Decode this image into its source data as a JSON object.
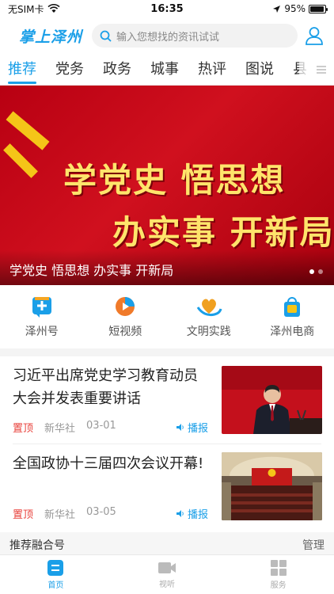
{
  "status_bar": {
    "carrier": "无SIM卡",
    "time": "16:35",
    "battery": "95%",
    "battery_level": 0.95
  },
  "header": {
    "logo": "掌上泽州",
    "search_placeholder": "输入您想找的资讯试试"
  },
  "tabs": [
    {
      "label": "推荐",
      "active": true
    },
    {
      "label": "党务"
    },
    {
      "label": "政务"
    },
    {
      "label": "城事"
    },
    {
      "label": "热评"
    },
    {
      "label": "图说"
    },
    {
      "label": "县"
    }
  ],
  "banner": {
    "line1": "学党史 悟思想",
    "line2": "办实事 开新局",
    "caption": "学党史 悟思想 办实事 开新局",
    "slides": 2,
    "current": 1
  },
  "quick_links": [
    {
      "label": "泽州号",
      "icon": "plus-badge-icon",
      "color": "#1a9fe8"
    },
    {
      "label": "短视频",
      "icon": "video-play-icon",
      "color": "#f07a2a"
    },
    {
      "label": "文明实践",
      "icon": "heart-hands-icon",
      "color": "#f0a020"
    },
    {
      "label": "泽州电商",
      "icon": "shopping-bag-icon",
      "color": "#1a9fe8"
    }
  ],
  "news": [
    {
      "title": "习近平出席党史学习教育动员大会并发表重要讲话",
      "pinned": "置顶",
      "source": "新华社",
      "date": "03-01",
      "listen": "播报"
    },
    {
      "title": "全国政协十三届四次会议开幕!",
      "pinned": "置顶",
      "source": "新华社",
      "date": "03-05",
      "listen": "播报"
    }
  ],
  "section": {
    "title": "推荐融合号",
    "manage": "管理"
  },
  "bottom_nav": [
    {
      "label": "首页",
      "icon": "home-icon",
      "active": true
    },
    {
      "label": "视听",
      "icon": "camera-icon"
    },
    {
      "label": "服务",
      "icon": "grid-icon"
    }
  ],
  "colors": {
    "accent": "#1a9fe8",
    "pin": "#e8413b",
    "banner_red": "#c8081a",
    "banner_text": "#ffe46b"
  }
}
